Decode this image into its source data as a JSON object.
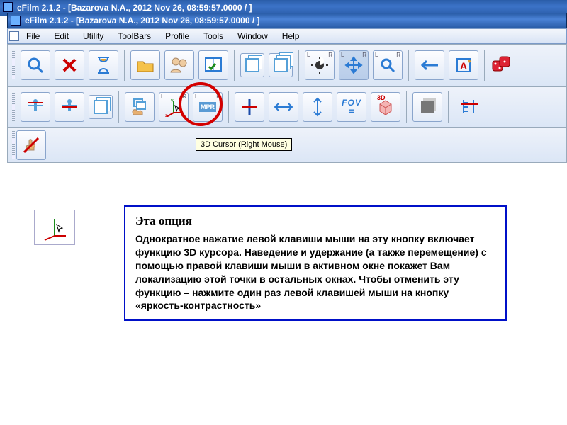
{
  "titlebarBack": "eFilm 2.1.2 - [Bazarova N.A., 2012 Nov 26, 08:59:57.0000  /  ]",
  "titlebarFront": "eFilm 2.1.2 - [Bazarova N.A., 2012 Nov 26, 08:59:57.0000  /  ]",
  "menus": {
    "file": "File",
    "edit": "Edit",
    "utility": "Utility",
    "toolbars": "ToolBars",
    "profile": "Profile",
    "tools": "Tools",
    "window": "Window",
    "help": "Help"
  },
  "tooltip": "3D Cursor (Right Mouse)",
  "row2Labels": {
    "mpr": "MPR",
    "fov": "FOV",
    "eq": "=",
    "threeD": "3D"
  },
  "info": {
    "title": "Эта опция",
    "body": "Однократное нажатие левой клавиши мыши на эту кнопку  включает функцию 3D курсора. Наведение и удержание (а также перемещение) с помощью правой клавиши мыши в активном окне покажет Вам локализацию этой точки в остальных окнах. Чтобы отменить  эту функцию – нажмите один раз левой клавишей мыши на кнопку «яркость-контрастность»"
  }
}
